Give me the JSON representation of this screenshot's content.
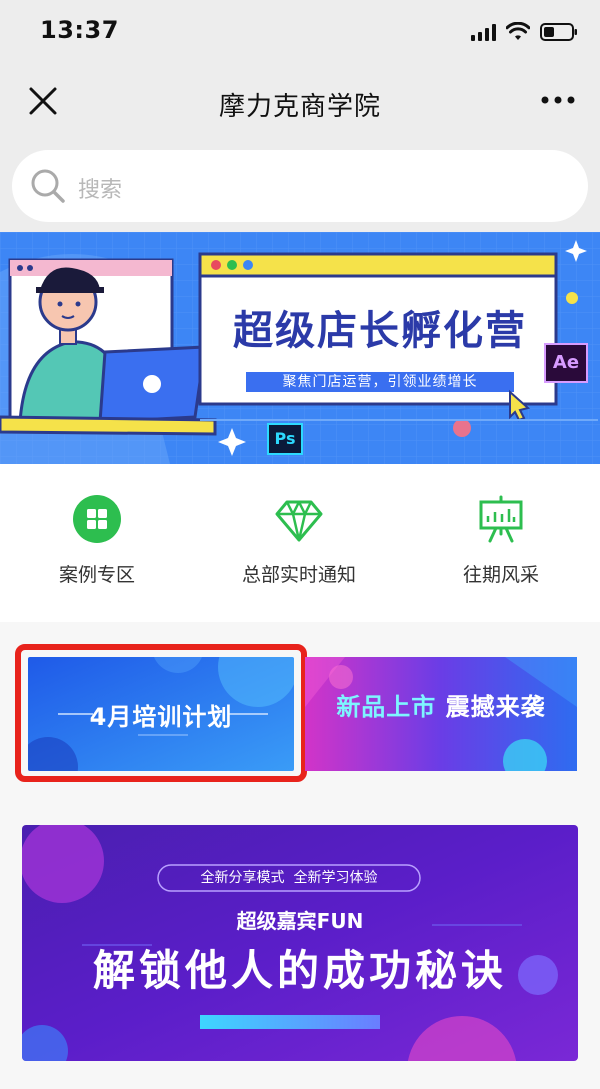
{
  "status_bar": {
    "time": "13:37"
  },
  "nav": {
    "title": "摩力克商学院"
  },
  "search": {
    "placeholder": "搜索"
  },
  "hero_banner": {
    "title": "超级店长孵化营",
    "subtitle": "聚焦门店运营，引领业绩增长",
    "badge_ps": "Ps",
    "badge_ae": "Ae"
  },
  "quick_nav": {
    "items": [
      {
        "label": "案例专区",
        "icon": "grid-icon"
      },
      {
        "label": "总部实时通知",
        "icon": "diamond-icon"
      },
      {
        "label": "往期风采",
        "icon": "easel-icon"
      }
    ],
    "accent": "#2dbe4f"
  },
  "promo": {
    "left": {
      "title": "4月培训计划"
    },
    "right": {
      "title_a": "新品上市",
      "title_b": "震撼来袭"
    },
    "highlight_color": "#e8231c"
  },
  "bottom_banner": {
    "tagline": "全新分享模式  全新学习体验",
    "subtitle": "超级嘉宾FUN",
    "title": "解锁他人的成功秘诀"
  }
}
